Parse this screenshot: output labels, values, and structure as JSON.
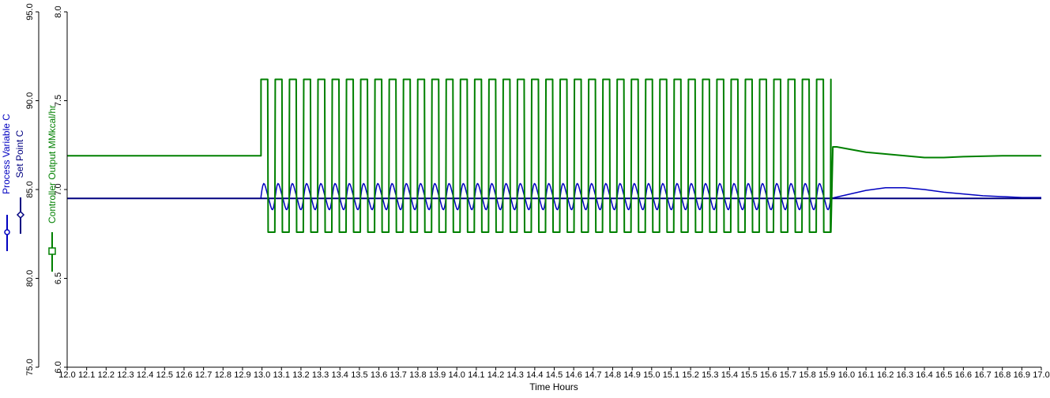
{
  "chart_data": {
    "type": "line",
    "title": "",
    "xlabel": "Time Hours",
    "xlim": [
      12.0,
      17.0
    ],
    "x_ticks": [
      "12.0",
      "12.1",
      "12.2",
      "12.3",
      "12.4",
      "12.5",
      "12.6",
      "12.7",
      "12.8",
      "12.9",
      "13.0",
      "13.1",
      "13.2",
      "13.3",
      "13.4",
      "13.5",
      "13.6",
      "13.7",
      "13.8",
      "13.9",
      "14.0",
      "14.1",
      "14.2",
      "14.3",
      "14.4",
      "14.5",
      "14.6",
      "14.7",
      "14.8",
      "14.9",
      "15.0",
      "15.1",
      "15.2",
      "15.3",
      "15.4",
      "15.5",
      "15.6",
      "15.7",
      "15.8",
      "15.9",
      "16.0",
      "16.1",
      "16.2",
      "16.3",
      "16.4",
      "16.5",
      "16.6",
      "16.7",
      "16.8",
      "16.9",
      "17.0"
    ],
    "left_axis": {
      "label_lines": [
        "Process Variable C",
        "Set Point C"
      ],
      "ylim": [
        75.0,
        95.0
      ],
      "ticks": [
        "75.0",
        "80.0",
        "85.0",
        "90.0",
        "95.0"
      ],
      "color": "#0000c0"
    },
    "right_axis": {
      "label": "Controller Output MMkcal/hr",
      "ylim": [
        6.0,
        8.0
      ],
      "ticks": [
        "6.0",
        "6.5",
        "7.0",
        "7.5",
        "8.0"
      ],
      "color": "#008000"
    },
    "series": [
      {
        "name": "Process Variable C",
        "axis": "left",
        "color": "#0000c0",
        "segments": [
          {
            "type": "line",
            "points": [
              [
                12.0,
                84.5
              ],
              [
                12.995,
                84.5
              ]
            ]
          },
          {
            "type": "oscillation",
            "x_start": 12.995,
            "x_end": 15.92,
            "center": 84.6,
            "amplitude": 0.7,
            "cycles": 40
          },
          {
            "type": "line",
            "points": [
              [
                15.92,
                84.5
              ],
              [
                16.0,
                84.7
              ],
              [
                16.1,
                84.95
              ],
              [
                16.2,
                85.1
              ],
              [
                16.3,
                85.1
              ],
              [
                16.4,
                85.0
              ],
              [
                16.5,
                84.85
              ],
              [
                16.6,
                84.75
              ],
              [
                16.7,
                84.65
              ],
              [
                16.8,
                84.6
              ],
              [
                16.9,
                84.55
              ],
              [
                17.0,
                84.55
              ]
            ]
          }
        ]
      },
      {
        "name": "Set Point C",
        "axis": "left",
        "color": "#000080",
        "segments": [
          {
            "type": "line",
            "points": [
              [
                12.0,
                84.5
              ],
              [
                17.0,
                84.5
              ]
            ]
          }
        ]
      },
      {
        "name": "Controller Output MMkcal/hr",
        "axis": "right",
        "color": "#008000",
        "segments": [
          {
            "type": "line",
            "points": [
              [
                12.0,
                7.19
              ],
              [
                12.995,
                7.19
              ]
            ]
          },
          {
            "type": "square",
            "x_start": 12.995,
            "x_end": 15.92,
            "high": 7.62,
            "low": 6.76,
            "cycles": 40
          },
          {
            "type": "line",
            "points": [
              [
                15.92,
                6.76
              ],
              [
                15.93,
                7.24
              ],
              [
                15.95,
                7.24
              ],
              [
                16.0,
                7.23
              ],
              [
                16.1,
                7.21
              ],
              [
                16.2,
                7.2
              ],
              [
                16.3,
                7.19
              ],
              [
                16.4,
                7.18
              ],
              [
                16.5,
                7.18
              ],
              [
                16.6,
                7.185
              ],
              [
                16.8,
                7.19
              ],
              [
                17.0,
                7.19
              ]
            ]
          }
        ]
      }
    ],
    "legend": [
      {
        "name": "Process Variable C",
        "marker": "circle",
        "color": "#0000c0"
      },
      {
        "name": "Set Point C",
        "marker": "diamond",
        "color": "#000080"
      },
      {
        "name": "Controller Output MMkcal/hr",
        "marker": "square",
        "color": "#008000"
      }
    ]
  }
}
